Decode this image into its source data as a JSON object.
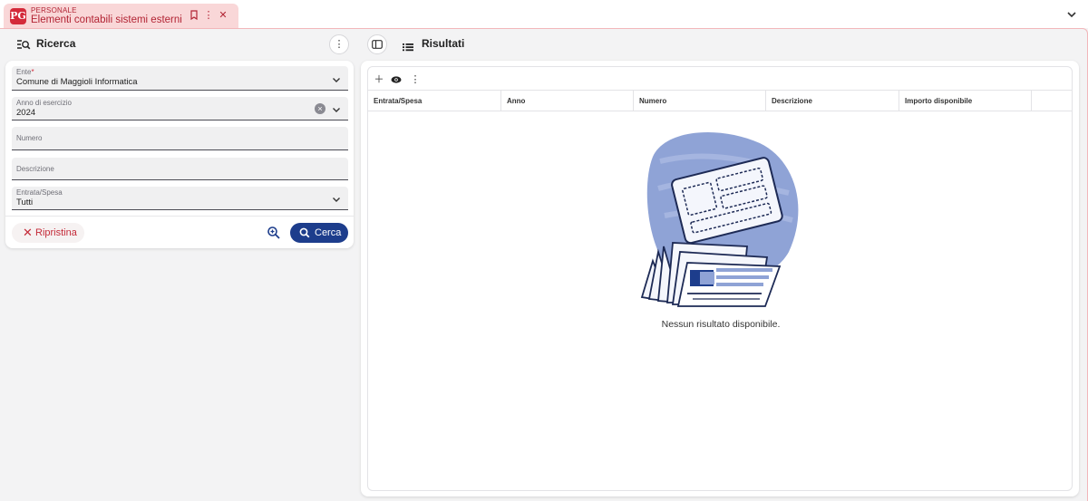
{
  "tab": {
    "category": "PERSONALE",
    "title": "Elementi contabili sistemi esterni",
    "logo_text": "PG"
  },
  "left_panel": {
    "title": "Ricerca",
    "fields": [
      {
        "label": "Ente",
        "required_mark": "*",
        "value": "Comune di Maggioli Informatica"
      },
      {
        "label": "Anno di esercizio",
        "value": "2024"
      },
      {
        "label": "Numero",
        "value": ""
      },
      {
        "label": "Descrizione",
        "value": ""
      },
      {
        "label": "Entrata/Spesa",
        "value": "Tutti"
      }
    ],
    "reset_label": "Ripristina",
    "search_label": "Cerca"
  },
  "right_panel": {
    "title": "Risultati",
    "columns": [
      "Entrata/Spesa",
      "Anno",
      "Numero",
      "Descrizione",
      "Importo disponibile"
    ],
    "empty_message": "Nessun risultato disponibile."
  },
  "colors": {
    "accent_red": "#d42a3a",
    "tab_background": "#f9d7d8",
    "primary_blue": "#1d3d8c",
    "illustration_blue": "#8fa3d6"
  },
  "icons": [
    "bookmark-icon",
    "more-vert-icon",
    "close-icon",
    "chevron-down-icon",
    "search-list-icon",
    "sidebar-toggle-icon",
    "list-icon",
    "plus-icon",
    "eye-icon",
    "zoom-in-icon",
    "search-icon",
    "clear-icon"
  ]
}
